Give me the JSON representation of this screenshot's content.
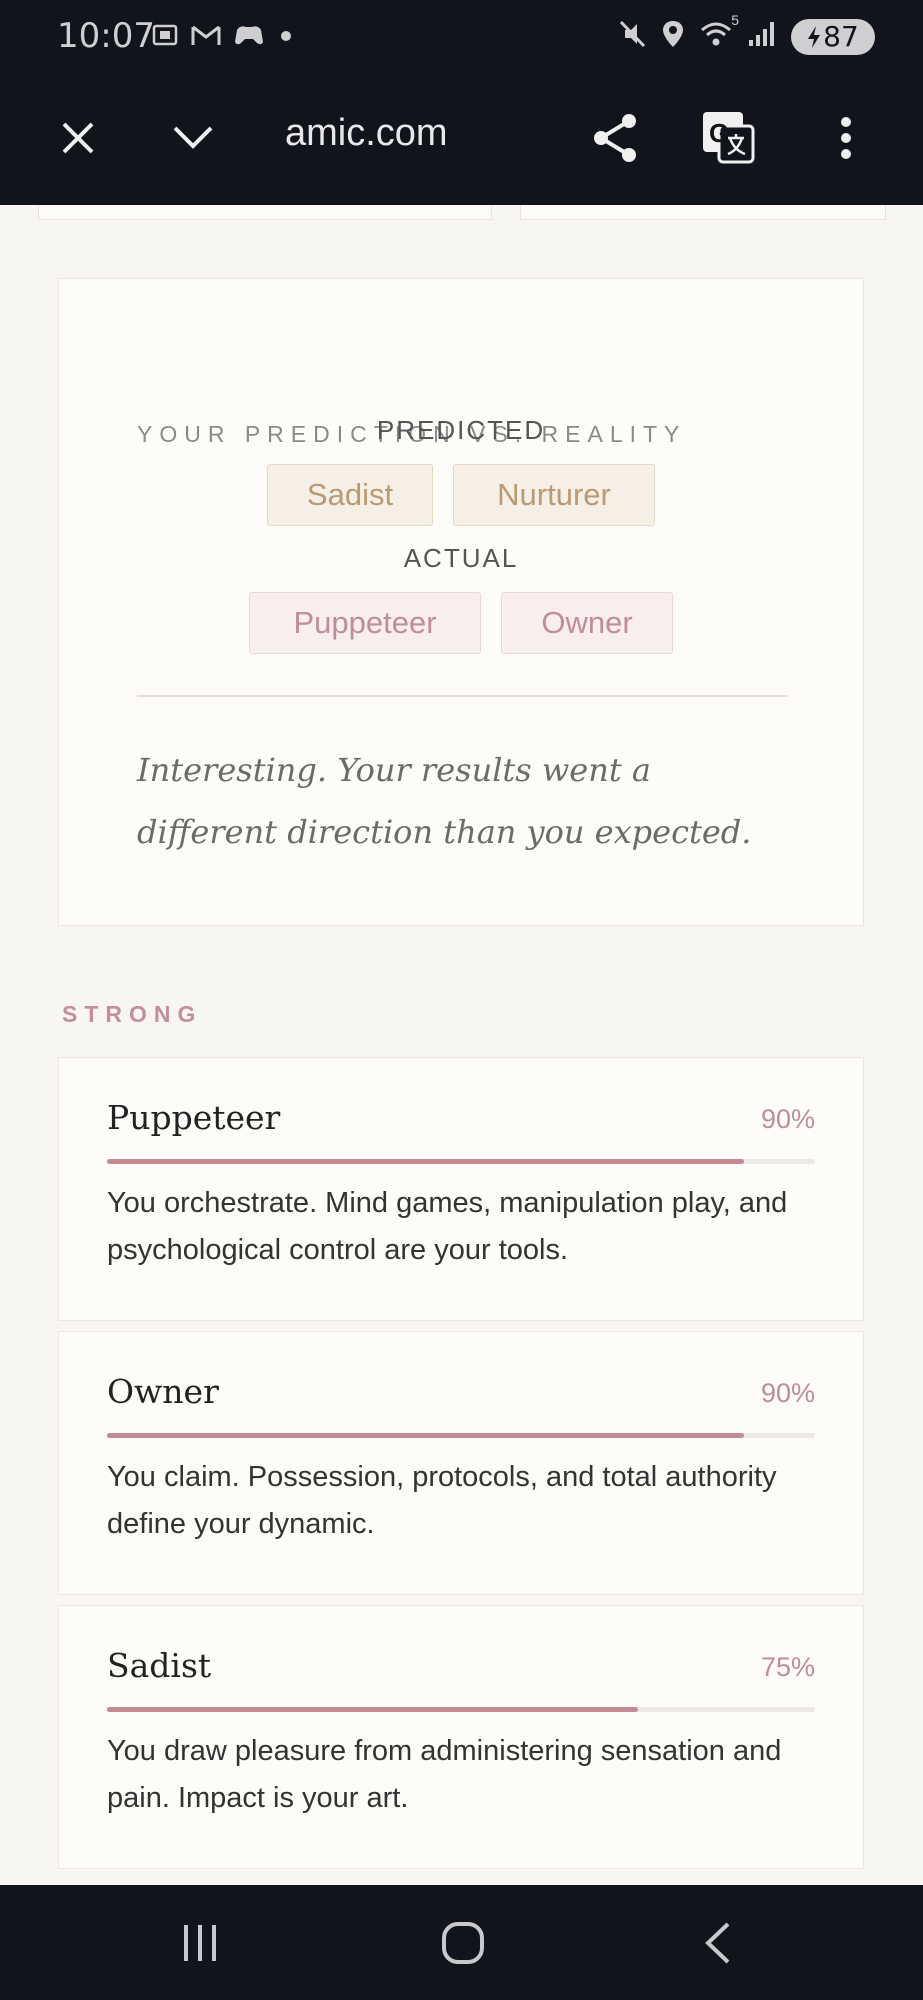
{
  "status_bar": {
    "time": "10:07",
    "left_icons": [
      "screenshot-icon",
      "gmail-icon",
      "game-controller-icon",
      "dot-icon"
    ],
    "right_icons": [
      "mute-icon",
      "location-icon",
      "wifi-icon",
      "signal-icon"
    ],
    "wifi_label": "5",
    "battery_level": "87",
    "battery_charging": true
  },
  "browser": {
    "url": "amic.com",
    "icons": [
      "close-icon",
      "chevron-down-icon",
      "share-icon",
      "translate-icon",
      "more-vert-icon"
    ]
  },
  "prediction_card": {
    "title": "YOUR PREDICTION VS. REALITY",
    "predicted_label": "PREDICTED",
    "predicted": [
      "Sadist",
      "Nurturer"
    ],
    "actual_label": "ACTUAL",
    "actual": [
      "Puppeteer",
      "Owner"
    ],
    "verdict": "Interesting. Your results went a different direction than you expected."
  },
  "strong_section": {
    "title": "STRONG",
    "items": [
      {
        "name": "Puppeteer",
        "percent_label": "90%",
        "percent": 90,
        "description": "You orchestrate. Mind games, manipulation play, and psychological control are your tools."
      },
      {
        "name": "Owner",
        "percent_label": "90%",
        "percent": 90,
        "description": "You claim. Possession, protocols, and total authority define your dynamic."
      },
      {
        "name": "Sadist",
        "percent_label": "75%",
        "percent": 75,
        "description": "You draw pleasure from administering sensation and pain. Impact is your art."
      }
    ]
  },
  "nav_bar": {
    "icons": [
      "recents-icon",
      "home-icon",
      "back-icon"
    ]
  },
  "colors": {
    "accent": "#c38b93",
    "predicted_chip": "#b99a72",
    "actual_chip": "#c08f96",
    "dark_bar": "#12141b"
  }
}
